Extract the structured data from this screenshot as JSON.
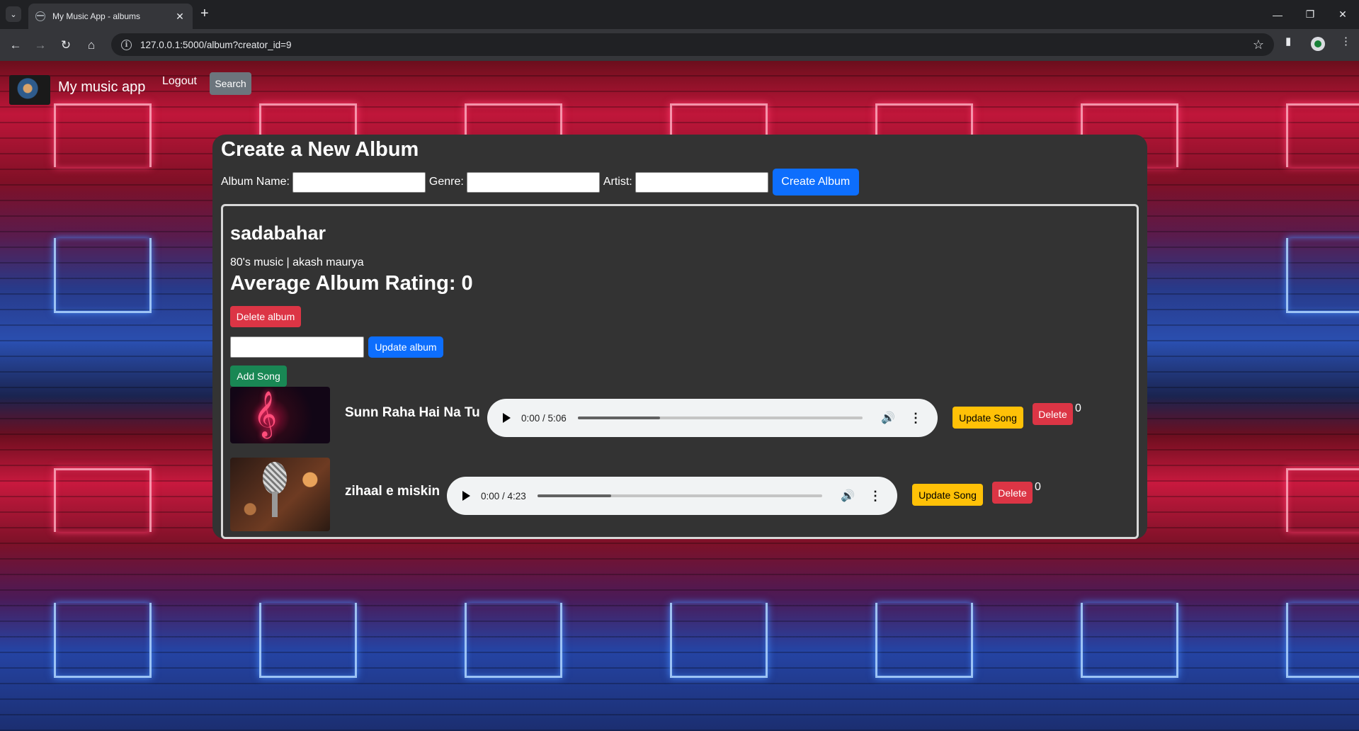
{
  "browser": {
    "tab_title": "My Music App - albums",
    "tab_close": "✕",
    "new_tab": "+",
    "url": "127.0.0.1:5000/album?creator_id=9"
  },
  "navbar": {
    "brand": "My music app",
    "logout": "Logout",
    "search": "Search"
  },
  "create_form": {
    "title": "Create a New Album",
    "album_name_label": "Album Name:",
    "genre_label": "Genre:",
    "artist_label": "Artist:",
    "album_name_value": "",
    "genre_value": "",
    "artist_value": "",
    "submit_label": "Create Album"
  },
  "album": {
    "name": "sadabahar",
    "meta": "80's music | akash maurya",
    "rating_text": "Average Album Rating: 0",
    "delete_label": "Delete album",
    "update_input_value": "",
    "update_label": "Update album",
    "add_song_label": "Add Song",
    "songs": [
      {
        "title": "Sunn Raha Hai Na Tu",
        "time": "0:00 / 5:06",
        "buffered_fraction": 0.29,
        "update_label": "Update Song",
        "delete_label": "Delete",
        "count": "0",
        "thumbnail": "treble-clef-image"
      },
      {
        "title": "zihaal e miskin",
        "time": "0:00 / 4:23",
        "buffered_fraction": 0.26,
        "update_label": "Update Song",
        "delete_label": "Delete",
        "count": "0",
        "thumbnail": "microphone-image"
      }
    ]
  },
  "colors": {
    "primary": "#0d6efd",
    "danger": "#dc3545",
    "success": "#198754",
    "warning": "#ffc107",
    "secondary": "#6c757d",
    "panel": "#333333"
  }
}
